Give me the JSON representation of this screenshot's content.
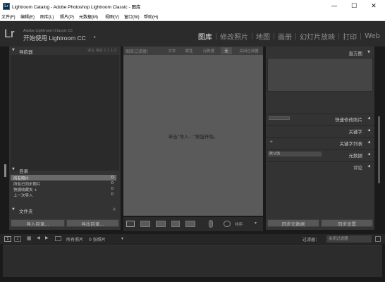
{
  "window": {
    "title": "Lightroom Catalog - Adobe Photoshop Lightroom Classic - 图库",
    "icon": "Lr",
    "controls": {
      "minimize": "—",
      "maximize": "☐",
      "close": "✕"
    }
  },
  "menu": [
    "文件(F)",
    "编辑(E)",
    "图库(L)",
    "照片(P)",
    "元数据(M)",
    "视图(V)",
    "窗口(W)",
    "帮助(H)"
  ],
  "identity": {
    "logo": "Lr",
    "small": "Adobe Lightroom Classic CC",
    "main": "开始使用 Lightroom CC",
    "arrow": "▸"
  },
  "modules": [
    {
      "label": "图库",
      "active": true
    },
    {
      "label": "修改照片",
      "active": false
    },
    {
      "label": "地图",
      "active": false
    },
    {
      "label": "画册",
      "active": false
    },
    {
      "label": "幻灯片放映",
      "active": false
    },
    {
      "label": "打印",
      "active": false
    },
    {
      "label": "Web",
      "active": false
    }
  ],
  "left_panel": {
    "navigator": {
      "title": "导航器",
      "options": "适合  填充  1:1  1:3"
    },
    "catalog": {
      "title": "目录",
      "items": [
        {
          "name": "所有照片",
          "count": "0",
          "selected": true
        },
        {
          "name": "所有已同步照片",
          "count": "0",
          "selected": false
        },
        {
          "name": "快捷收藏夹 +",
          "count": "0",
          "selected": false
        },
        {
          "name": "上一次导入",
          "count": "0",
          "selected": false
        }
      ]
    },
    "folders": {
      "title": "文件夹",
      "add": "+"
    },
    "import_button": "导入目录...",
    "export_button": "导出目录..."
  },
  "center": {
    "filter_label": "图库过滤器：",
    "filter_tabs": [
      {
        "label": "文本",
        "on": false
      },
      {
        "label": "属性",
        "on": false
      },
      {
        "label": "元数据",
        "on": false
      },
      {
        "label": "无",
        "on": true
      }
    ],
    "filter_off": "关闭过滤器",
    "empty_message": "单击\"导入...\"按钮开始。",
    "sort_label": "排序:",
    "sort_arrow": "▾"
  },
  "right_panel": {
    "histogram": "直方图",
    "sections": [
      {
        "label": "快速修改照片"
      },
      {
        "label": "关键字"
      },
      {
        "label": "关键字列表",
        "prefix": "+"
      },
      {
        "label": "元数据",
        "prefix": "默认值"
      },
      {
        "label": "评论"
      }
    ],
    "sync_metadata": "同步元数据",
    "sync_settings": "同步设置"
  },
  "filmstrip": {
    "page1": "1",
    "page2": "2",
    "source": "所有照片",
    "count": "0 张照片",
    "filter_label": "过滤器：",
    "filter_value": "关闭过滤器"
  }
}
